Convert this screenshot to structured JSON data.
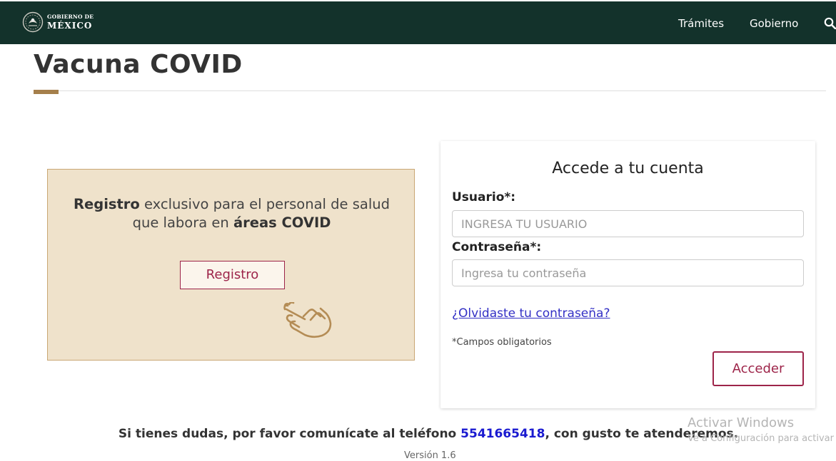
{
  "header": {
    "logo_small": "GOBIERNO DE",
    "logo_big": "MÉXICO",
    "nav": [
      "Trámites",
      "Gobierno"
    ],
    "bg_color": "#13322b",
    "search_icon": "search-icon"
  },
  "page": {
    "title": "Vacuna COVID",
    "accent_color": "#a57f4b"
  },
  "promo": {
    "text_bold1": "Registro",
    "text_mid": " exclusivo para el personal de salud que labora en ",
    "text_bold2": "áreas COVID",
    "button_label": "Registro",
    "icon": "hand-pointer-icon",
    "bg_color": "#efe2cb"
  },
  "login": {
    "title": "Accede a tu cuenta",
    "user_label": "Usuario*:",
    "user_placeholder": "INGRESA TU USUARIO",
    "user_value": "",
    "pass_label": "Contraseña*:",
    "pass_placeholder": "Ingresa tu contraseña",
    "pass_value": "",
    "forgot_link": "¿Olvidaste tu contraseña?",
    "required_note": "*Campos obligatorios",
    "submit_label": "Acceder",
    "button_color": "#9d2449"
  },
  "footer": {
    "help_prefix": "Si tienes dudas, por favor comunícate al teléfono ",
    "phone": "5541665418",
    "help_suffix": ", con gusto te atenderemos.",
    "version": "Versión 1.6"
  },
  "watermark": {
    "title": "Activar Windows",
    "subtitle": "Ve a Configuración para activar"
  }
}
